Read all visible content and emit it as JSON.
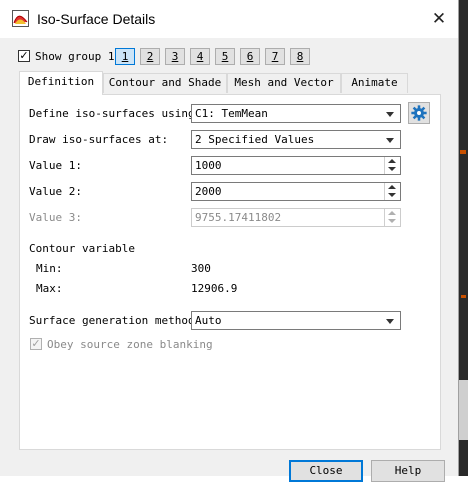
{
  "window": {
    "title": "Iso-Surface Details",
    "close_glyph": "✕",
    "icon": "iso-surface-app-icon"
  },
  "show_group": {
    "label": "Show group 1",
    "checked": true,
    "groups": [
      "1",
      "2",
      "3",
      "4",
      "5",
      "6",
      "7",
      "8"
    ],
    "selected": "1"
  },
  "tabs": [
    {
      "label": "Definition",
      "selected": true
    },
    {
      "label": "Contour and Shade",
      "selected": false
    },
    {
      "label": "Mesh and Vector",
      "selected": false
    },
    {
      "label": "Animate",
      "selected": false
    }
  ],
  "definition": {
    "define_label": "Define iso-surfaces using:",
    "define_value": "C1: TemMean",
    "draw_label": "Draw iso-surfaces at:",
    "draw_value": "2 Specified Values",
    "value1_label": "Value 1:",
    "value1": "1000",
    "value2_label": "Value 2:",
    "value2": "2000",
    "value3_label": "Value 3:",
    "value3": "9755.17411802",
    "contour_heading": "Contour variable",
    "min_label": "Min:",
    "min_value": "300",
    "max_label": "Max:",
    "max_value": "12906.9",
    "surface_method_label": "Surface generation method:",
    "surface_method_value": "Auto",
    "obey_label": "Obey source zone blanking",
    "obey_checked": true
  },
  "footer": {
    "close_label": "Close",
    "help_label": "Help"
  },
  "colors": {
    "accent": "#0078d7",
    "gear": "#1e73be"
  }
}
